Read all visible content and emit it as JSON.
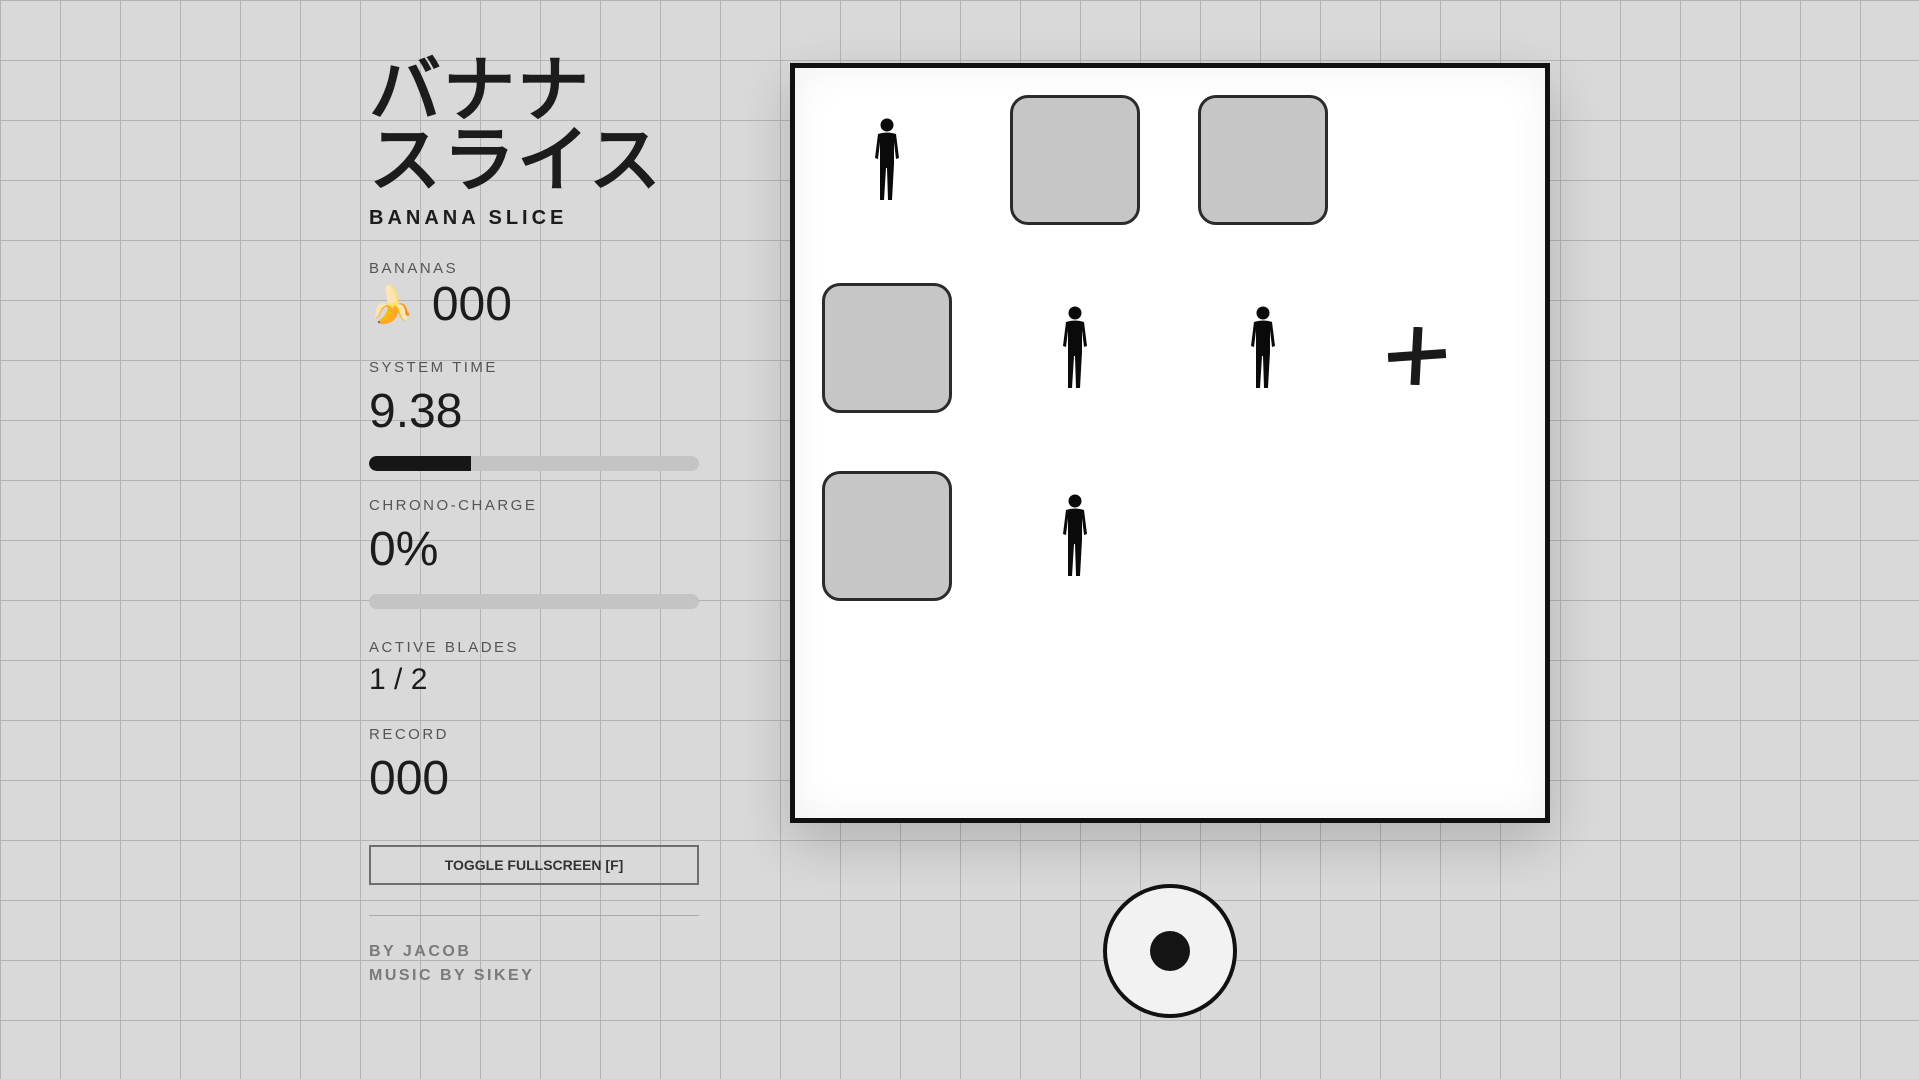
{
  "title_jp_line1": "バナナ",
  "title_jp_line2": "スライス",
  "title_en": "BANANA SLICE",
  "stats": {
    "bananas_label": "BANANAS",
    "bananas_icon": "banana-emoji",
    "bananas_value": "000",
    "system_time_label": "SYSTEM TIME",
    "system_time_value": "9.38",
    "system_time_progress": 0.31,
    "chrono_label": "CHRONO-CHARGE",
    "chrono_value": "0%",
    "chrono_progress": 0,
    "blades_label": "ACTIVE BLADES",
    "blades_value": "1 / 2",
    "record_label": "RECORD",
    "record_value": "000"
  },
  "fullscreen_button": "TOGGLE FULLSCREEN [F]",
  "credits": {
    "author": "BY JACOB",
    "music": "MUSIC BY SIKEY"
  },
  "board": {
    "grid_size": 4,
    "cells": [
      [
        "person",
        "tile",
        "tile",
        "empty"
      ],
      [
        "tile",
        "person",
        "person",
        "crosshair"
      ],
      [
        "tile",
        "person",
        "empty",
        "empty"
      ],
      [
        "empty",
        "empty",
        "empty",
        "empty"
      ]
    ]
  },
  "colors": {
    "background": "#d9d9d9",
    "grid_line": "#b3b3b3",
    "board_bg": "#ffffff",
    "tile_fill": "#c6c6c6",
    "ink": "#111111"
  }
}
